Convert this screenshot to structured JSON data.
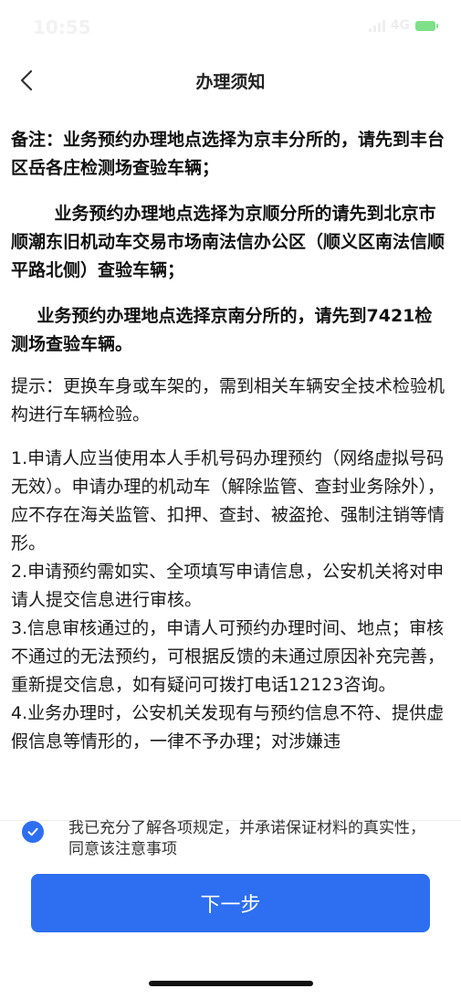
{
  "status_bar": {
    "time": "10:55",
    "network": "4G"
  },
  "nav": {
    "title": "办理须知"
  },
  "content": {
    "notice_1": "备注：业务预约办理地点选择为京丰分所的，请先到丰台区岳各庄检测场查验车辆；",
    "notice_2": "业务预约办理地点选择为京顺分所的请先到北京市顺潮东旧机动车交易市场南法信办公区（顺义区南法信顺平路北侧）查验车辆；",
    "notice_3": "业务预约办理地点选择京南分所的，请先到7421检测场查验车辆。",
    "tip": "提示：更换车身或车架的，需到相关车辆安全技术检验机构进行车辆检验。",
    "rules": [
      "1.申请人应当使用本人手机号码办理预约（网络虚拟号码无效）。申请办理的机动车（解除监管、查封业务除外），应不存在海关监管、扣押、查封、被盗抢、强制注销等情形。",
      "2.申请预约需如实、全项填写申请信息，公安机关将对申请人提交信息进行审核。",
      "3.信息审核通过的，申请人可预约办理时间、地点；审核不通过的无法预约，可根据反馈的未通过原因补充完善，重新提交信息，如有疑问可拨打电话12123咨询。",
      "4.业务办理时，公安机关发现有与预约信息不符、提供虚假信息等情形的，一律不予办理；对涉嫌违"
    ]
  },
  "agreement": {
    "checked": true,
    "text": "我已充分了解各项规定，并承诺保证材料的真实性， 同意该注意事项"
  },
  "footer": {
    "next_label": "下一步"
  },
  "colors": {
    "primary": "#2d6ff0",
    "text": "#1a1a1a",
    "background": "#ffffff"
  },
  "icons": {
    "back": "chevron-left-icon",
    "checkbox": "check-circle-icon"
  }
}
